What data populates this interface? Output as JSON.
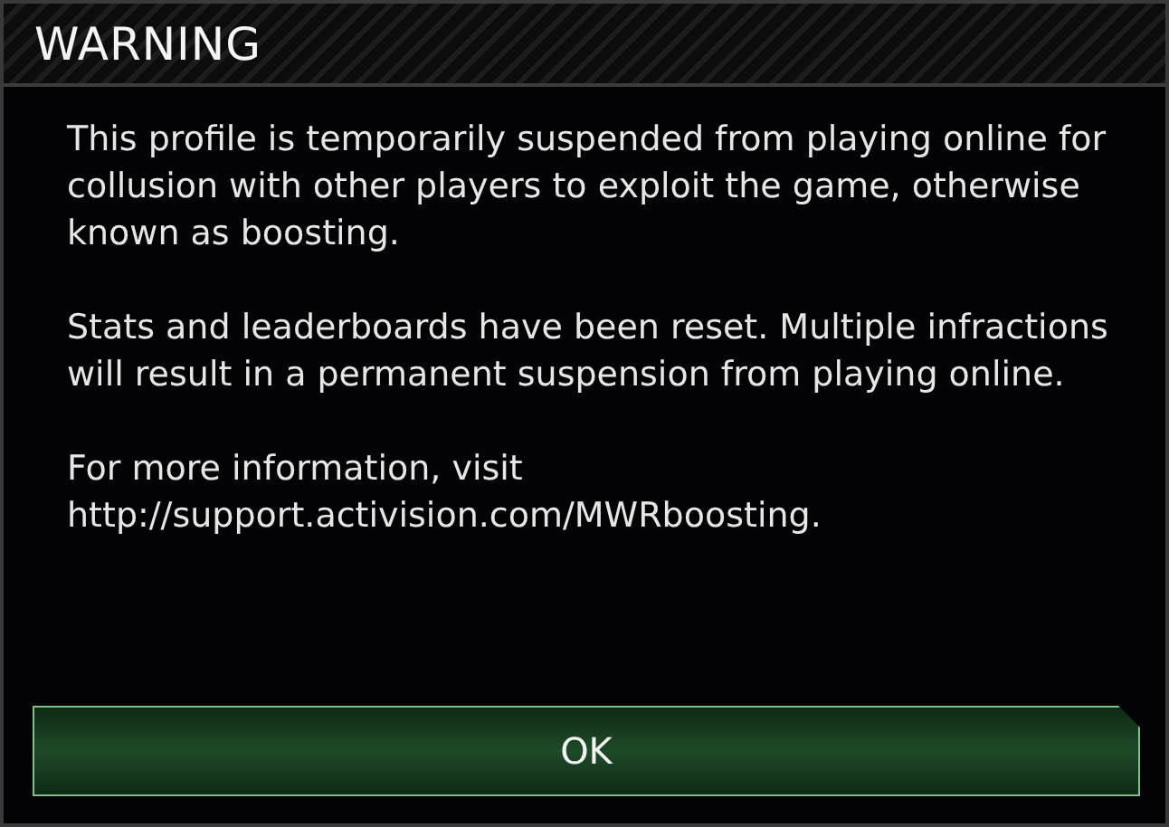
{
  "dialog": {
    "title": "WARNING",
    "paragraphs": [
      "This profile is temporarily suspended from playing online for collusion with other players to exploit the game, otherwise known as boosting.",
      "Stats and leaderboards have been reset. Multiple infractions will result in a permanent suspension from playing online.",
      "For more information, visit http://support.activision.com/MWRboosting."
    ],
    "buttons": [
      {
        "label": "OK"
      }
    ]
  }
}
